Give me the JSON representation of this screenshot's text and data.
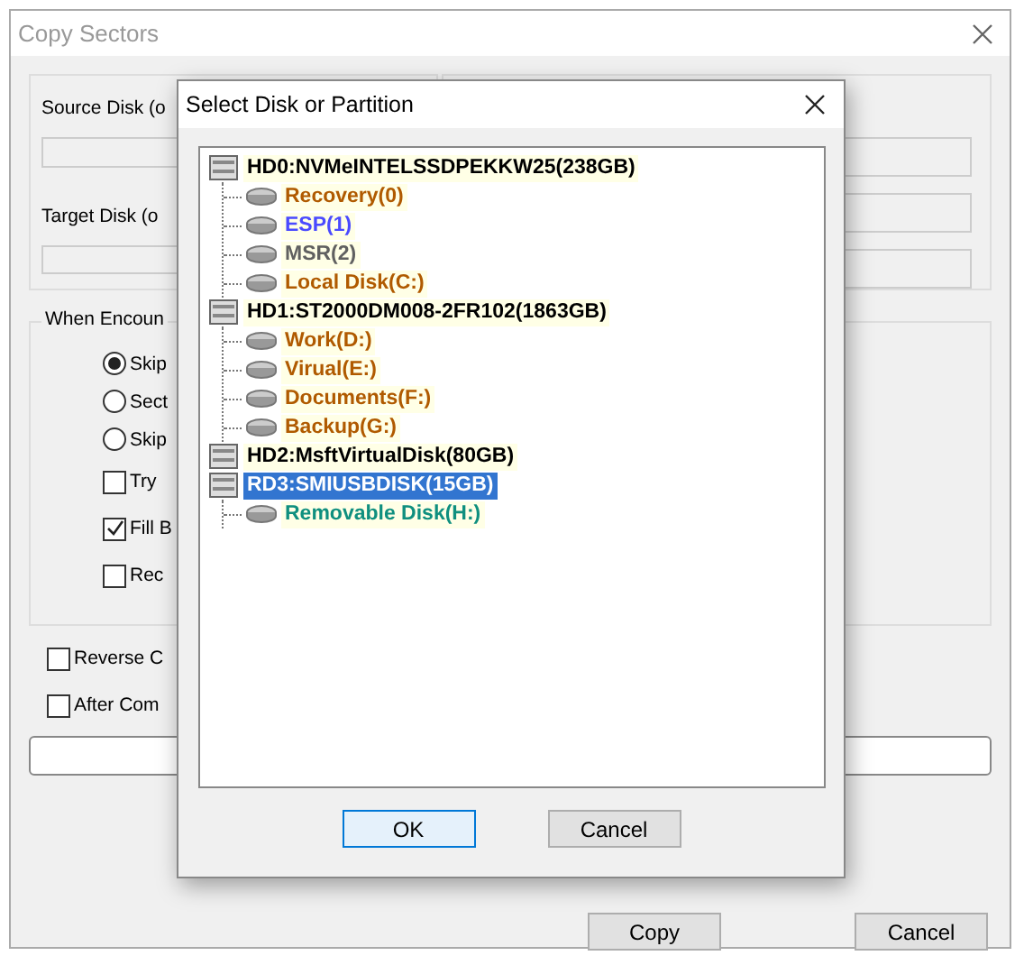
{
  "window": {
    "title": "Copy Sectors"
  },
  "source_label": "Source Disk (o",
  "target_label": "Target Disk (o",
  "error_group": {
    "title": "When Encoun",
    "options": [
      {
        "kind": "radio",
        "label": "Skip",
        "selected": true
      },
      {
        "kind": "radio",
        "label": "Sect",
        "selected": false
      },
      {
        "kind": "radio",
        "label": "Skip",
        "selected": false
      },
      {
        "kind": "checkbox",
        "label": "Try",
        "checked": false
      },
      {
        "kind": "checkbox",
        "label": "Fill B",
        "checked": true
      },
      {
        "kind": "checkbox",
        "label": "Rec",
        "checked": false
      }
    ]
  },
  "options": [
    {
      "label": "Reverse C",
      "checked": false
    },
    {
      "label": "After Com",
      "checked": false
    }
  ],
  "buttons": [
    "Copy",
    "Cancel"
  ],
  "dialog": {
    "title": "Select Disk or Partition",
    "tree": [
      {
        "label": "HD0:NVMeINTELSSDPEKKW25(238GB)",
        "selected": false,
        "children": [
          {
            "label": "Recovery(0)",
            "color": "#b05a00"
          },
          {
            "label": "ESP(1)",
            "color": "#4a4aff"
          },
          {
            "label": "MSR(2)",
            "color": "#606060"
          },
          {
            "label": "Local Disk(C:)",
            "color": "#b05a00"
          }
        ]
      },
      {
        "label": "HD1:ST2000DM008-2FR102(1863GB)",
        "selected": false,
        "children": [
          {
            "label": "Work(D:)",
            "color": "#b05a00"
          },
          {
            "label": "Virual(E:)",
            "color": "#b05a00"
          },
          {
            "label": "Documents(F:)",
            "color": "#b05a00"
          },
          {
            "label": "Backup(G:)",
            "color": "#b05a00"
          }
        ]
      },
      {
        "label": "HD2:MsftVirtualDisk(80GB)",
        "selected": false
      },
      {
        "label": "RD3:SMIUSBDISK(15GB)",
        "selected": true,
        "children": [
          {
            "label": "Removable Disk(H:)",
            "color": "#0f8f7f"
          }
        ]
      }
    ],
    "buttons": [
      "OK",
      "Cancel"
    ]
  }
}
